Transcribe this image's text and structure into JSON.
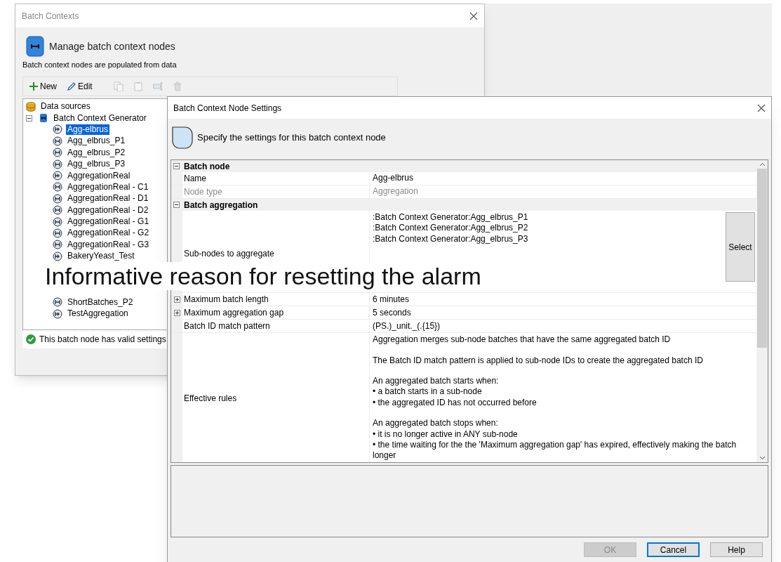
{
  "batch_contexts_window": {
    "title": "Batch Contexts",
    "heading": "Manage batch context nodes",
    "subtitle": "Batch context nodes are populated from data",
    "toolbar": [
      {
        "kind": "new",
        "label": "New",
        "disabled": false
      },
      {
        "kind": "edit",
        "label": "Edit",
        "disabled": false
      },
      {
        "kind": "copy",
        "disabled": true
      },
      {
        "kind": "paste",
        "disabled": true
      },
      {
        "kind": "rename",
        "disabled": true
      },
      {
        "kind": "delete",
        "disabled": true
      }
    ],
    "tree": [
      {
        "label": "Data sources",
        "kind": "database",
        "selected": false
      },
      {
        "label": "Batch Context Generator",
        "kind": "generator",
        "expanded": true,
        "selected": false,
        "children": [
          {
            "label": "Agg-elbrus",
            "kind": "aggregation",
            "selected": true
          },
          {
            "label": "Agg_elbrus_P1",
            "kind": "batch",
            "selected": false
          },
          {
            "label": "Agg_elbrus_P2",
            "kind": "batch",
            "selected": false
          },
          {
            "label": "Agg_elbrus_P3",
            "kind": "batch",
            "selected": false
          },
          {
            "label": "AggregationReal",
            "kind": "aggregation",
            "selected": false
          },
          {
            "label": "AggregationReal - C1",
            "kind": "batch",
            "selected": false
          },
          {
            "label": "AggregationReal - D1",
            "kind": "batch",
            "selected": false
          },
          {
            "label": "AggregationReal - D2",
            "kind": "batch",
            "selected": false
          },
          {
            "label": "AggregationReal - G1",
            "kind": "batch",
            "selected": false
          },
          {
            "label": "AggregationReal - G2",
            "kind": "batch",
            "selected": false
          },
          {
            "label": "AggregationReal - G3",
            "kind": "batch",
            "selected": false
          },
          {
            "label": "BakeryYeast_Test",
            "kind": "aggregation",
            "selected": false
          },
          {
            "label": "ShortBatches_P2",
            "kind": "batch",
            "selected": false
          },
          {
            "label": "TestAggregation",
            "kind": "aggregation",
            "selected": false
          }
        ]
      }
    ],
    "status": "This batch node has valid settings"
  },
  "settings_window": {
    "title": "Batch Context Node Settings",
    "heading": "Specify the settings for this batch context node",
    "sections": [
      {
        "title": "Batch node",
        "expanded": true,
        "rows": [
          {
            "label": "Name",
            "value_paragraphs": [
              [
                "Agg-elbrus"
              ]
            ],
            "disabled": false
          },
          {
            "label": "Node type",
            "value_paragraphs": [
              [
                "Aggregation"
              ]
            ],
            "disabled": true
          }
        ]
      },
      {
        "title": "Batch aggregation",
        "expanded": true,
        "rows": [
          {
            "label": "Sub-nodes to aggregate",
            "value_paragraphs": [
              [
                ":Batch Context Generator:Agg_elbrus_P1",
                ":Batch Context Generator:Agg_elbrus_P2",
                ":Batch Context Generator:Agg_elbrus_P3"
              ]
            ],
            "button": "Select",
            "disabled": false
          },
          {
            "label": "Maximum batch length",
            "value_paragraphs": [
              [
                "6 minutes"
              ]
            ],
            "expanded": false,
            "disabled": false
          },
          {
            "label": "Maximum aggregation gap",
            "value_paragraphs": [
              [
                "5 seconds"
              ]
            ],
            "expanded": false,
            "disabled": false
          },
          {
            "label": "Batch ID match pattern",
            "value_paragraphs": [
              [
                "(PS.)_unit._(.{15})"
              ]
            ],
            "disabled": false
          },
          {
            "label": "Effective rules",
            "value_paragraphs": [
              [
                "Aggregation merges sub-node batches that have the same aggregated batch ID"
              ],
              [
                "The Batch ID match pattern is applied to sub-node IDs to create the aggregated batch ID"
              ],
              [
                "An aggregated batch starts when:",
                "• a batch starts in a sub-node",
                "• the aggregated ID has not occurred before"
              ],
              [
                "An aggregated batch stops when:",
                "• it is no longer active in ANY sub-node",
                "• the time waiting for the the 'Maximum aggregation gap' has expired, effectively making the batch longer"
              ]
            ],
            "disabled": false
          }
        ]
      }
    ],
    "buttons": [
      {
        "label": "OK",
        "disabled": true,
        "default": false
      },
      {
        "label": "Cancel",
        "disabled": false,
        "default": true
      },
      {
        "label": "Help",
        "disabled": false,
        "default": false
      }
    ]
  },
  "caption": "Informative reason for resetting the alarm"
}
